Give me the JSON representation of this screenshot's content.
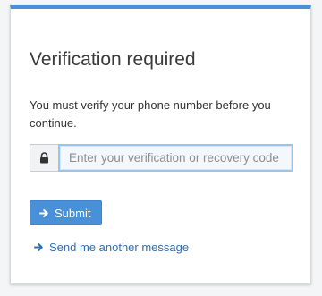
{
  "title": "Verification required",
  "description": "You must verify your phone number before you continue.",
  "code_input": {
    "placeholder": "Enter your verification or recovery code",
    "value": ""
  },
  "submit_label": "Submit",
  "resend_label": "Send me another message",
  "icons": {
    "addon": "lock-icon",
    "submit": "arrow-right-icon",
    "resend": "arrow-right-icon"
  },
  "colors": {
    "accent": "#4a90d9",
    "link": "#2f6fb0"
  }
}
